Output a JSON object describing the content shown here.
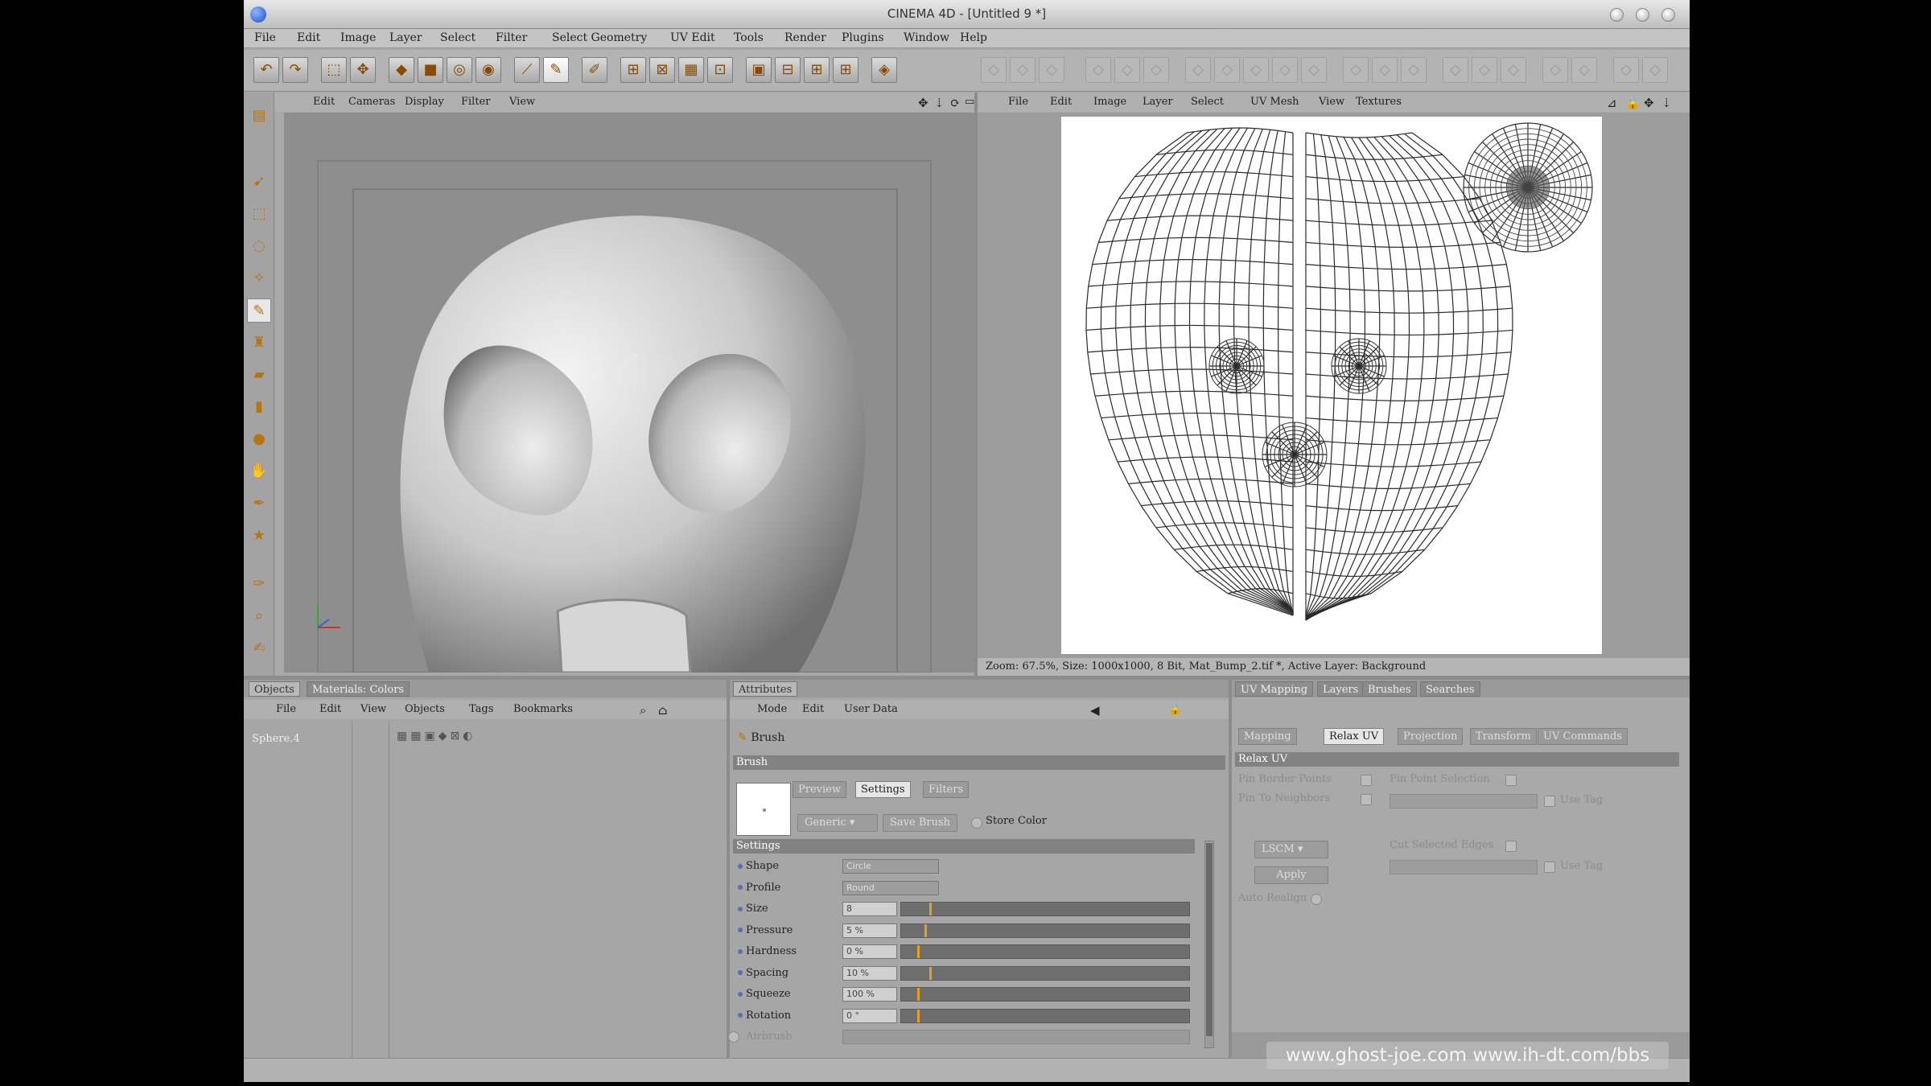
{
  "window": {
    "title": "CINEMA 4D - [Untitled 9 *]"
  },
  "menu": [
    "File",
    "Edit",
    "Image",
    "Layer",
    "Select",
    "Filter",
    "Select Geometry",
    "UV Edit",
    "Tools",
    "Render",
    "Plugins",
    "Window",
    "Help"
  ],
  "viewport_menu": [
    "Edit",
    "Cameras",
    "Display",
    "Filter",
    "View"
  ],
  "bodypaint_menu": [
    "File",
    "Edit",
    "Image",
    "Layer",
    "Select",
    "UV Mesh",
    "View",
    "Textures"
  ],
  "bodypaint_status": "Zoom: 67.5%, Size: 1000x1000, 8 Bit, Mat_Bump_2.tif *, Active Layer: Background",
  "objects_panel": {
    "tabs": [
      "Objects",
      "Materials: Colors"
    ],
    "menu": [
      "File",
      "Edit",
      "View",
      "Objects",
      "Tags",
      "Bookmarks"
    ],
    "object_name": "Sphere.4"
  },
  "attributes_panel": {
    "tab": "Attributes",
    "menu": [
      "Mode",
      "Edit",
      "User Data"
    ],
    "tool_name": "Brush",
    "section": "Brush",
    "subtabs": [
      "Preview",
      "Settings",
      "Filters"
    ],
    "preset_dropdown": "Generic",
    "save_brush": "Save Brush",
    "store_color": "Store Color",
    "settings_header": "Settings",
    "params": [
      {
        "label": "Shape",
        "value": "Circle",
        "kind": "dropdown"
      },
      {
        "label": "Profile",
        "value": "Round",
        "kind": "dropdown"
      },
      {
        "label": "Size",
        "value": "8",
        "kind": "slider",
        "level": 0.27
      },
      {
        "label": "Pressure",
        "value": "5 %",
        "kind": "slider",
        "level": 0.22
      },
      {
        "label": "Hardness",
        "value": "0 %",
        "kind": "slider",
        "level": 0.15
      },
      {
        "label": "Spacing",
        "value": "10 %",
        "kind": "slider",
        "level": 0.27
      },
      {
        "label": "Squeeze",
        "value": "100 %",
        "kind": "slider",
        "level": 0.15
      },
      {
        "label": "Rotation",
        "value": "0 °",
        "kind": "slider",
        "level": 0.15
      },
      {
        "label": "Airbrush",
        "value": "",
        "kind": "check"
      }
    ]
  },
  "uv_panel": {
    "tabs": [
      "UV Mapping",
      "Layers",
      "Brushes",
      "Searches"
    ],
    "subtabs": [
      "Mapping",
      "Relax UV",
      "Projection",
      "Transform",
      "UV Commands"
    ],
    "section": "Relax UV",
    "pin_border": "Pin Border Points",
    "pin_neighbors": "Pin To Neighbors",
    "pin_selection": "Pin Point Selection",
    "use_tag_1": "Use Tag",
    "lscm": "LSCM",
    "apply": "Apply",
    "auto_realign": "Auto Realign",
    "cut_edges": "Cut Selected Edges",
    "use_tag_2": "Use Tag"
  },
  "watermark": "www.ghost-joe.com  www.ih-dt.com/bbs",
  "colors": {
    "accent": "#e2a11e",
    "ui_grey": "#a8a8a8"
  }
}
